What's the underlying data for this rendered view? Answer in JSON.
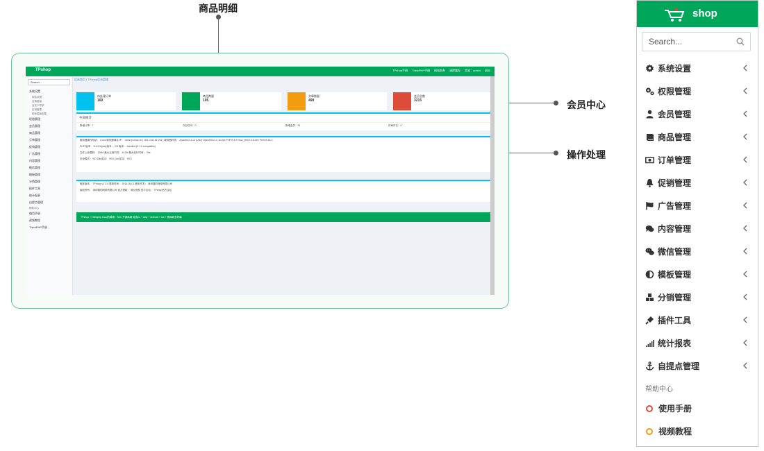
{
  "callouts": {
    "product_detail": "商品明细",
    "member_center": "会员中心",
    "operation": "操作处理"
  },
  "preview": {
    "brand": "TPshop",
    "top_links": [
      "TPshop手册",
      "ThinkPHP手册",
      "网站前台",
      "清除缓存",
      "欢迎：admin",
      "退出"
    ],
    "search_placeholder": "Search...",
    "breadcrumb": "后台首页 / TPshop后台管理",
    "side_items": [
      "系统设置",
      "权限管理",
      "会员管理",
      "商品管理",
      "订单管理",
      "促销管理",
      "广告管理",
      "内容管理",
      "微信管理",
      "模板管理",
      "分销管理",
      "插件工具",
      "统计报表",
      "自提点管理"
    ],
    "side_subitems": [
      "网站设置",
      "友情链接",
      "自定义导航",
      "区域管理",
      "短信模板配置"
    ],
    "help_header": "帮助中心",
    "help_items": [
      "使用手册",
      "视频教程",
      "ThinkPHP手册"
    ],
    "stats": [
      {
        "label": "待处理订单",
        "value": "160",
        "color": "#00c0ef"
      },
      {
        "label": "商品数量",
        "value": "105",
        "color": "#00a65a"
      },
      {
        "label": "文章数量",
        "value": "499",
        "color": "#f39c12"
      },
      {
        "label": "会员总数",
        "value": "3215",
        "color": "#dd4b39"
      }
    ],
    "today_title": "今日统计",
    "today_row": [
      "新增订单：7",
      "今日访问：0",
      "新增会员：51",
      "待审评论：0"
    ],
    "server_rows": [
      "服务器操作系统： Linux    服务器域名/IP： www.tp-shop.cn [ 183.134.161.201 ]    服务器环境： Apache/2.4.12 (Unix) OpenSSL/1.0.1e-fips PHP/5.6.9 mod_perl/2.0.8-dev Perl/v5.16.3",
      "PHP 版本： 5.6.9    Mysql 版本：     GD 版本： bundled (2.1.0 compatible)",
      "文件上传限制： 128M    最大占用内存： 512M    最大执行时间： 30s",
      "安全模式： NO    Zlib支持： YES    Curl支持： YES"
    ],
    "info_rows": [
      "程序版本： TPshop v1.3.5    更新时间： 2016-05-01    程序开发： 深圳搜豹网络有限公司",
      "版权所有： 深圳搜豹网络有限公司    官方授权： 商业授权    官方论坛： TPshop官方论坛"
    ],
    "footer_text": "TPshop（Thinkphp shop的简称）B2C 开源商城 免费pc + wap + android + ios + 微商城多终端"
  },
  "sidebar": {
    "brand": "shop",
    "search_placeholder": "Search...",
    "items": [
      {
        "label": "系统设置",
        "icon": "gear-icon"
      },
      {
        "label": "权限管理",
        "icon": "gears-icon"
      },
      {
        "label": "会员管理",
        "icon": "user-icon"
      },
      {
        "label": "商品管理",
        "icon": "book-icon"
      },
      {
        "label": "订单管理",
        "icon": "money-icon"
      },
      {
        "label": "促销管理",
        "icon": "bell-icon"
      },
      {
        "label": "广告管理",
        "icon": "flag-icon"
      },
      {
        "label": "内容管理",
        "icon": "comments-icon"
      },
      {
        "label": "微信管理",
        "icon": "wechat-icon"
      },
      {
        "label": "模板管理",
        "icon": "adjust-icon"
      },
      {
        "label": "分销管理",
        "icon": "cubes-icon"
      },
      {
        "label": "插件工具",
        "icon": "plug-icon"
      },
      {
        "label": "统计报表",
        "icon": "signal-icon"
      },
      {
        "label": "自提点管理",
        "icon": "anchor-icon"
      }
    ],
    "help_header": "帮助中心",
    "help_items": [
      {
        "label": "使用手册",
        "color": "#dd4b39"
      },
      {
        "label": "视频教程",
        "color": "#f39c12"
      }
    ]
  }
}
